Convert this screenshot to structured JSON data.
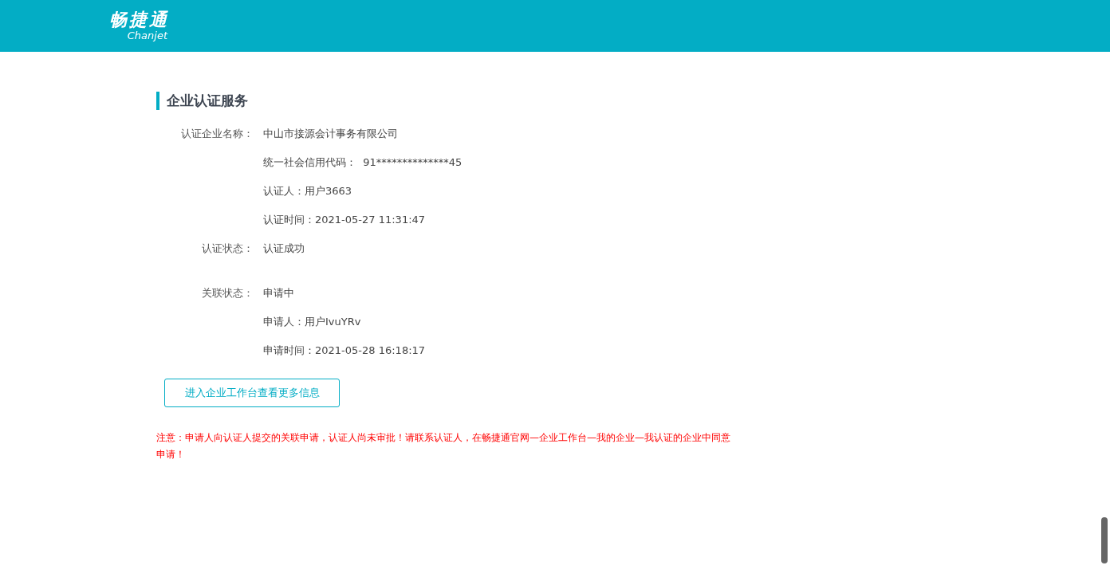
{
  "header": {
    "logo_cn": "畅捷通",
    "logo_en": "Chanjet"
  },
  "section_title": "企业认证服务",
  "groups": [
    {
      "label": "认证企业名称：",
      "lines": [
        "中山市接源会计事务有限公司",
        "统一社会信用代码：  91**************45",
        "认证人：用户3663",
        "认证时间：2021-05-27 11:31:47"
      ]
    },
    {
      "label": "认证状态：",
      "lines": [
        "认证成功"
      ]
    },
    {
      "label": "关联状态：",
      "lines": [
        "申请中",
        "申请人：用户IvuYRv",
        "申请时间：2021-05-28 16:18:17"
      ]
    }
  ],
  "button": "进入企业工作台查看更多信息",
  "notice": "注意：申请人向认证人提交的关联申请，认证人尚未审批！请联系认证人，在畅捷通官网—企业工作台—我的企业—我认证的企业中同意申请！"
}
